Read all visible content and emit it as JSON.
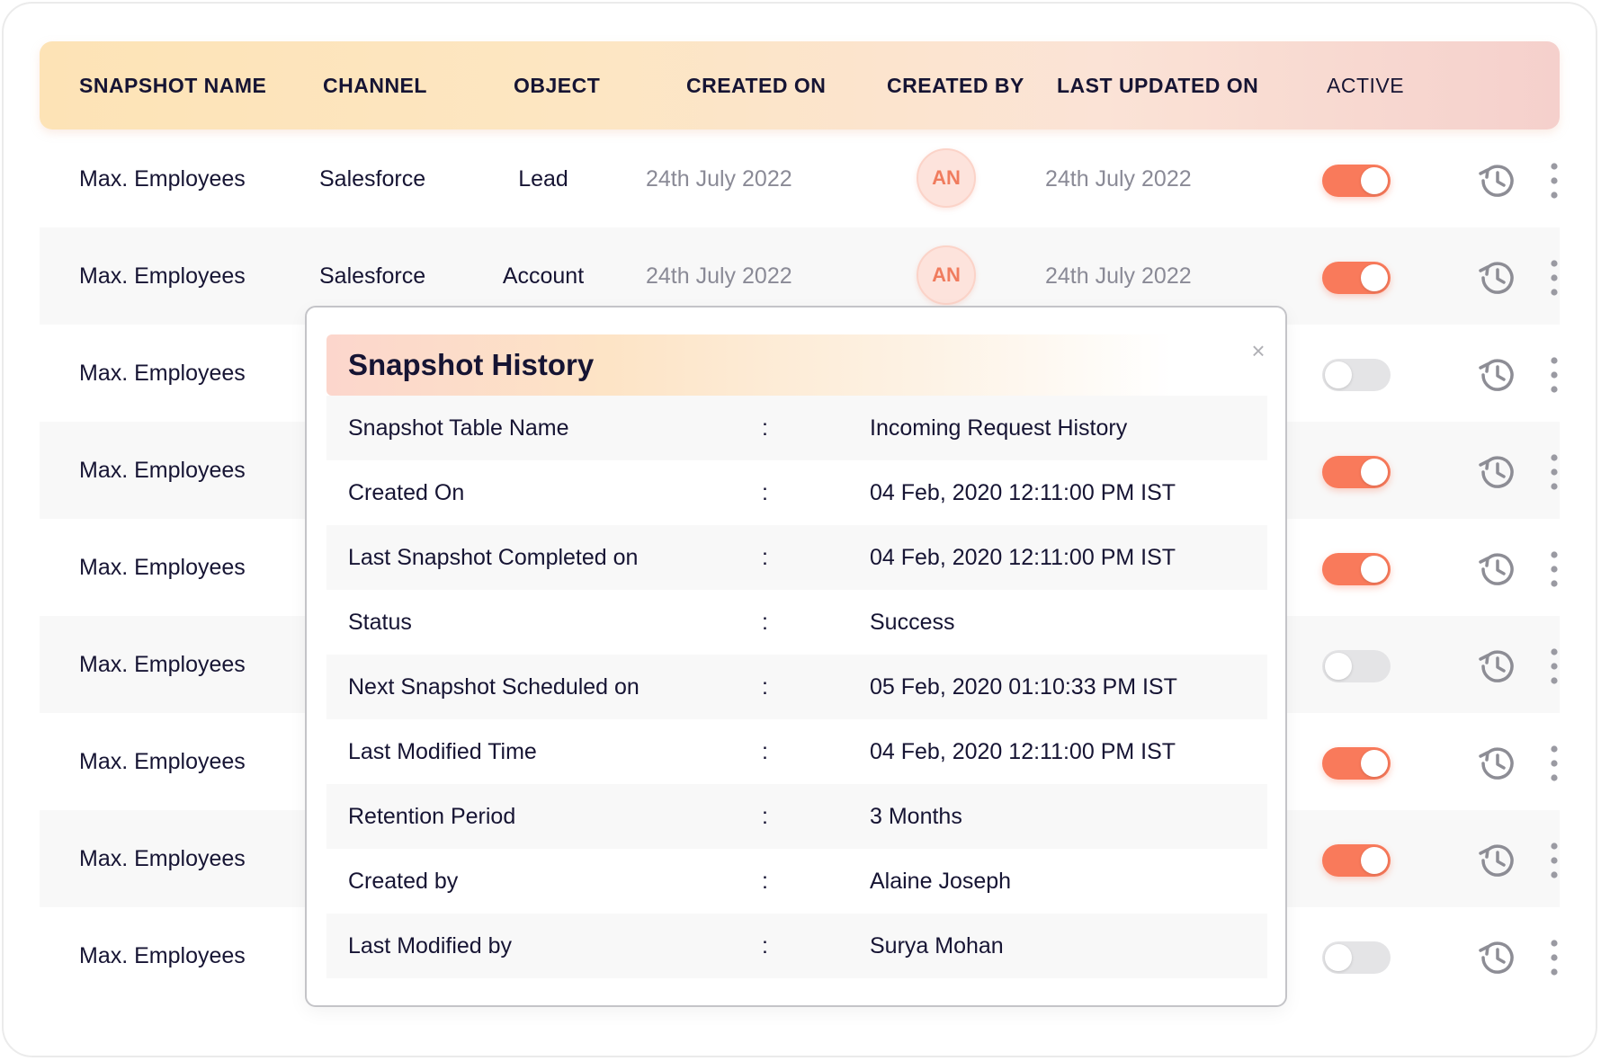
{
  "table": {
    "columns": [
      "SNAPSHOT NAME",
      "CHANNEL",
      "OBJECT",
      "CREATED ON",
      "CREATED BY",
      "LAST UPDATED ON",
      "ACTIVE"
    ],
    "rows": [
      {
        "name": "Max. Employees",
        "channel": "Salesforce",
        "object": "Lead",
        "created_on": "24th July 2022",
        "created_by": "AN",
        "updated_on": "24th July 2022",
        "active": true
      },
      {
        "name": "Max. Employees",
        "channel": "Salesforce",
        "object": "Account",
        "created_on": "24th July 2022",
        "created_by": "AN",
        "updated_on": "24th July 2022",
        "active": true
      },
      {
        "name": "Max. Employees",
        "active": false
      },
      {
        "name": "Max. Employees",
        "active": true
      },
      {
        "name": "Max. Employees",
        "active": true
      },
      {
        "name": "Max. Employees",
        "active": false
      },
      {
        "name": "Max. Employees",
        "active": true
      },
      {
        "name": "Max. Employees",
        "active": true
      },
      {
        "name": "Max. Employees",
        "active": false
      }
    ]
  },
  "modal": {
    "title": "Snapshot History",
    "close_label": "×",
    "separator": ":",
    "fields": [
      {
        "label": "Snapshot Table Name",
        "value": "Incoming Request History"
      },
      {
        "label": "Created On",
        "value": "04 Feb, 2020 12:11:00 PM IST"
      },
      {
        "label": "Last Snapshot Completed on",
        "value": "04 Feb, 2020 12:11:00 PM IST"
      },
      {
        "label": "Status",
        "value": "Success"
      },
      {
        "label": "Next Snapshot Scheduled on",
        "value": "05 Feb, 2020 01:10:33 PM IST"
      },
      {
        "label": "Last Modified Time",
        "value": "04 Feb, 2020 12:11:00 PM IST"
      },
      {
        "label": "Retention Period",
        "value": "3 Months"
      },
      {
        "label": "Created by",
        "value": "Alaine Joseph"
      },
      {
        "label": "Last Modified by",
        "value": "Surya Mohan"
      }
    ]
  },
  "icons": {
    "history": "history-icon",
    "more": "kebab-icon",
    "close": "close-icon"
  },
  "colors": {
    "accent": "#f97a5b",
    "toggle_off": "#e4e4e6",
    "avatar_text": "#f07c5e"
  }
}
